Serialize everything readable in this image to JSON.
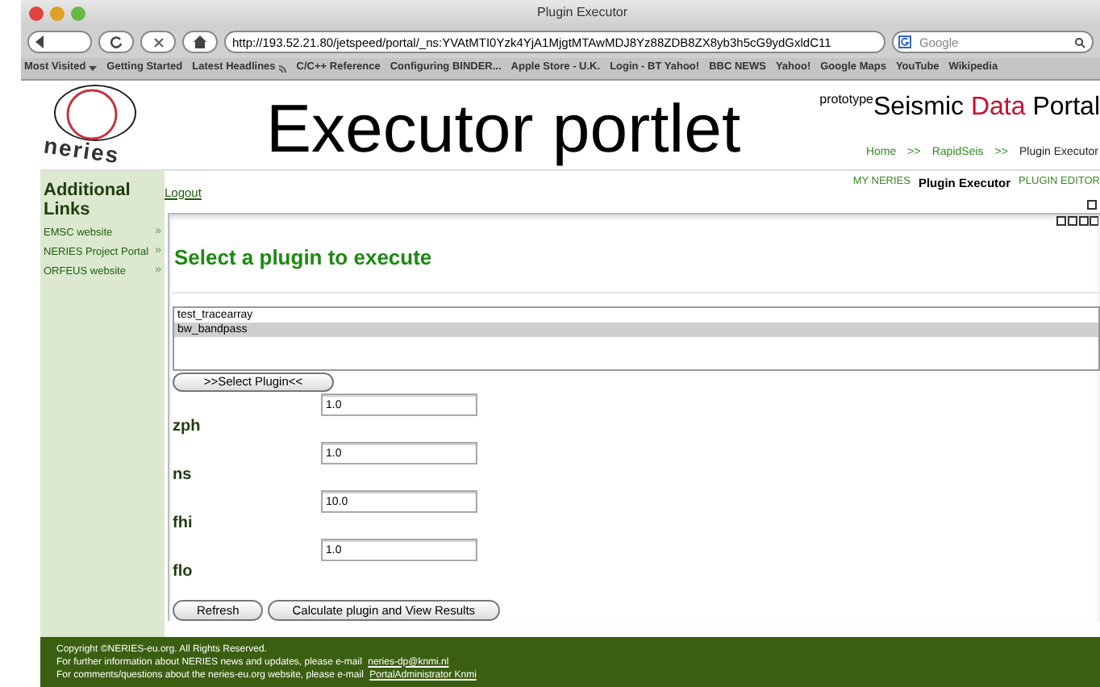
{
  "window": {
    "title": "Plugin Executor"
  },
  "toolbar": {
    "url": "http://193.52.21.80/jetspeed/portal/_ns:YVAtMTI0Yzk4YjA1MjgtMTAwMDJ8Yz88ZDB8ZX8yb3h5cG9ydGxldC11",
    "search_placeholder": "Google"
  },
  "bookmarks": [
    {
      "label": "Most Visited",
      "kind": "menu"
    },
    {
      "label": "Getting Started",
      "kind": "link"
    },
    {
      "label": "Latest Headlines",
      "kind": "feed"
    },
    {
      "label": "C/C++ Reference",
      "kind": "link"
    },
    {
      "label": "Configuring BINDER...",
      "kind": "link"
    },
    {
      "label": "Apple Store - U.K.",
      "kind": "link"
    },
    {
      "label": "Login - BT Yahoo!",
      "kind": "link"
    },
    {
      "label": "BBC NEWS",
      "kind": "link"
    },
    {
      "label": "Yahoo!",
      "kind": "link"
    },
    {
      "label": "Google Maps",
      "kind": "link"
    },
    {
      "label": "YouTube",
      "kind": "link"
    },
    {
      "label": "Wikipedia",
      "kind": "link"
    }
  ],
  "logo": {
    "text": "neries"
  },
  "overlay_title": "Executor portlet",
  "portal": {
    "prefix": "prototype",
    "title_parts": [
      "Seismic ",
      "Data",
      " Portal"
    ]
  },
  "breadcrumb": [
    "Home",
    ">>",
    "RapidSeis",
    ">>",
    "Plugin Executor"
  ],
  "nav_tabs": [
    {
      "label": "MY NERIES",
      "selected": false
    },
    {
      "label": "Plugin Executor",
      "selected": true
    },
    {
      "label": "PLUGIN EDITOR",
      "selected": false
    }
  ],
  "sidebar": {
    "title": "Additional Links",
    "items": [
      {
        "label": "EMSC website",
        "arrow": "»"
      },
      {
        "label": "NERIES Project Portal",
        "arrow": "»"
      },
      {
        "label": "ORFEUS website",
        "arrow": "»"
      }
    ]
  },
  "logout": "Logout",
  "portlet": {
    "heading": "Select a plugin to execute",
    "plugins": [
      {
        "label": "test_tracearray",
        "selected": false
      },
      {
        "label": "bw_bandpass",
        "selected": true
      }
    ],
    "select_button": ">>Select Plugin<<",
    "params": [
      {
        "label": "zph",
        "value": "1.0"
      },
      {
        "label": "ns",
        "value": "1.0"
      },
      {
        "label": "fhi",
        "value": "10.0"
      },
      {
        "label": "flo",
        "value": "1.0"
      }
    ],
    "buttons": [
      "Refresh",
      "Calculate plugin and View Results"
    ]
  },
  "footer": [
    {
      "text": "Copyright ©NERIES-eu.org. All Rights Reserved."
    },
    {
      "text": "For further information about NERIES news and updates, please e-mail ",
      "link": "neries-dp@knmi.nl"
    },
    {
      "text": "For comments/questions about the neries-eu.org website, please e-mail ",
      "link": "PortalAdministrator Knmi"
    }
  ]
}
